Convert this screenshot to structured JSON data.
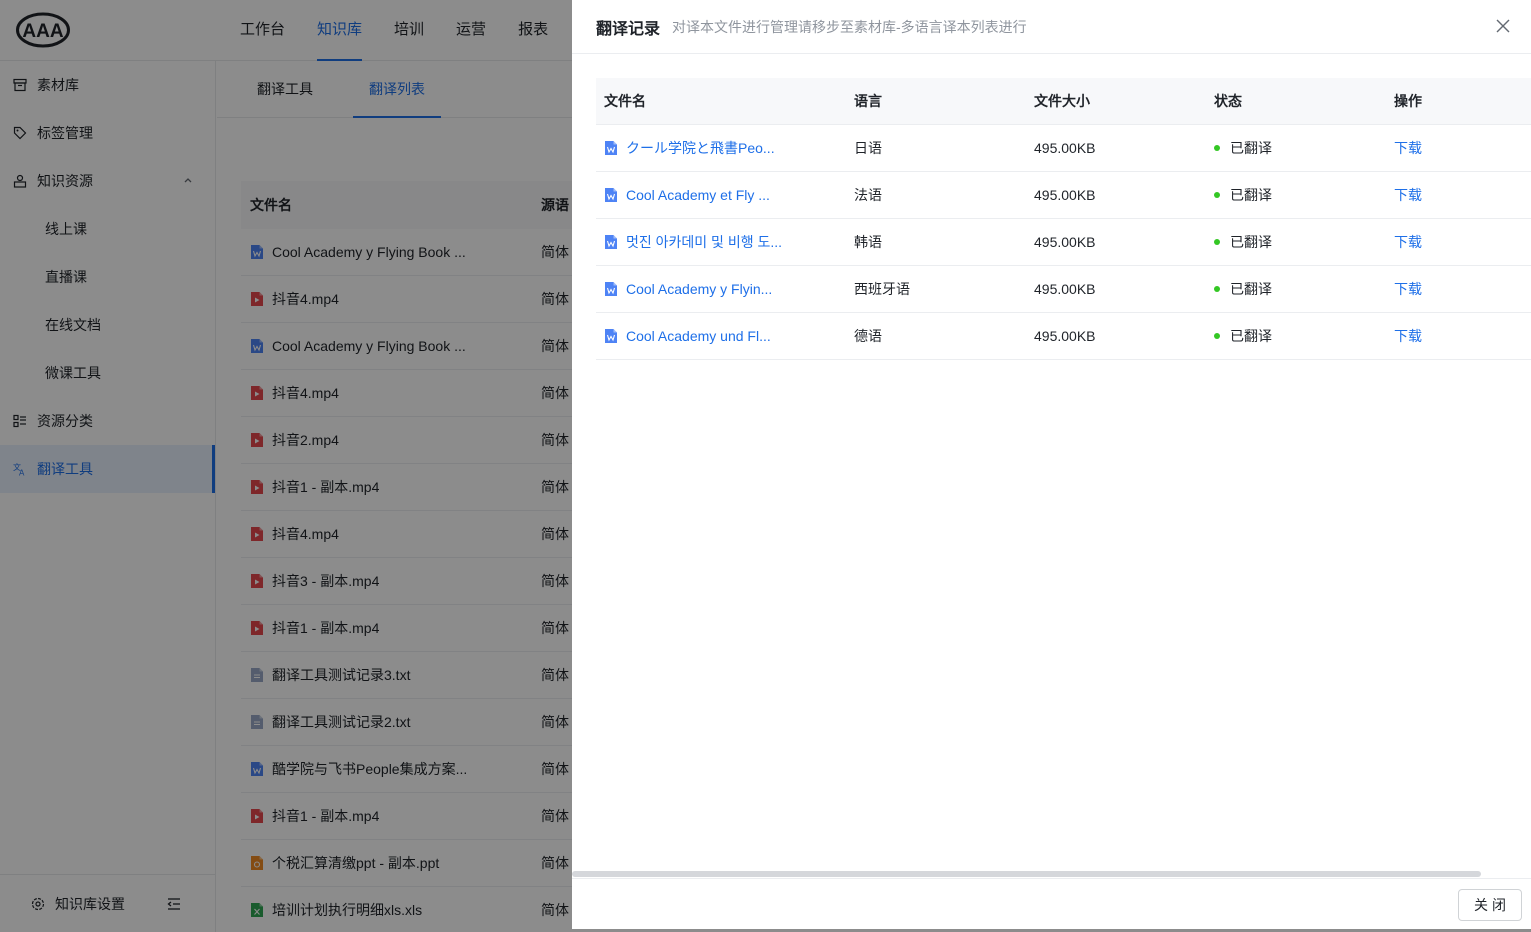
{
  "app": {
    "logo_text": "AAA",
    "top_nav": [
      "工作台",
      "知识库",
      "培训",
      "运营",
      "报表"
    ],
    "top_nav_active": 1
  },
  "sidebar": {
    "items": [
      {
        "label": "素材库",
        "icon": "archive-icon"
      },
      {
        "label": "标签管理",
        "icon": "tag-icon"
      },
      {
        "label": "知识资源",
        "icon": "resource-icon"
      },
      {
        "label": "线上课"
      },
      {
        "label": "直播课"
      },
      {
        "label": "在线文档"
      },
      {
        "label": "微课工具"
      },
      {
        "label": "资源分类",
        "icon": "category-icon"
      },
      {
        "label": "翻译工具",
        "icon": "translate-icon"
      }
    ],
    "footer_label": "知识库设置"
  },
  "subtabs": [
    "翻译工具",
    "翻译列表"
  ],
  "list": {
    "headers": [
      "文件名",
      "源语"
    ],
    "rows": [
      {
        "name": "Cool Academy y Flying Book ...",
        "type": "doc",
        "src": "简体"
      },
      {
        "name": "抖音4.mp4",
        "type": "video",
        "src": "简体"
      },
      {
        "name": "Cool Academy y Flying Book ...",
        "type": "doc",
        "src": "简体"
      },
      {
        "name": "抖音4.mp4",
        "type": "video",
        "src": "简体"
      },
      {
        "name": "抖音2.mp4",
        "type": "video",
        "src": "简体"
      },
      {
        "name": "抖音1 - 副本.mp4",
        "type": "video",
        "src": "简体"
      },
      {
        "name": "抖音4.mp4",
        "type": "video",
        "src": "简体"
      },
      {
        "name": "抖音3 - 副本.mp4",
        "type": "video",
        "src": "简体"
      },
      {
        "name": "抖音1 - 副本.mp4",
        "type": "video",
        "src": "简体"
      },
      {
        "name": "翻译工具测试记录3.txt",
        "type": "txt",
        "src": "简体"
      },
      {
        "name": "翻译工具测试记录2.txt",
        "type": "txt",
        "src": "简体"
      },
      {
        "name": "酷学院与飞书People集成方案...",
        "type": "doc",
        "src": "简体"
      },
      {
        "name": "抖音1 - 副本.mp4",
        "type": "video",
        "src": "简体"
      },
      {
        "name": "个税汇算清缴ppt - 副本.ppt",
        "type": "ppt",
        "src": "简体"
      },
      {
        "name": "培训计划执行明细xls.xls",
        "type": "xls",
        "src": "简体"
      }
    ]
  },
  "drawer": {
    "title": "翻译记录",
    "subtitle": "对译本文件进行管理请移步至素材库-多语言译本列表进行",
    "headers": {
      "name": "文件名",
      "lang": "语言",
      "size": "文件大小",
      "status": "状态",
      "op": "操作"
    },
    "rows": [
      {
        "name": "クール学院と飛書Peo...",
        "lang": "日语",
        "size": "495.00KB",
        "status": "已翻译",
        "op": "下载"
      },
      {
        "name": "Cool Academy et Fly ...",
        "lang": "法语",
        "size": "495.00KB",
        "status": "已翻译",
        "op": "下载"
      },
      {
        "name": "멋진 아카데미 및 비행 도...",
        "lang": "韩语",
        "size": "495.00KB",
        "status": "已翻译",
        "op": "下载"
      },
      {
        "name": "Cool Academy y Flyin...",
        "lang": "西班牙语",
        "size": "495.00KB",
        "status": "已翻译",
        "op": "下载"
      },
      {
        "name": "Cool Academy und Fl...",
        "lang": "德语",
        "size": "495.00KB",
        "status": "已翻译",
        "op": "下载"
      }
    ],
    "close_label": "关闭"
  },
  "colors": {
    "accent": "#1e6fe8",
    "status_ok": "#34c724",
    "doc_icon": "#4e83f5",
    "video_icon": "#e5484d",
    "txt_icon": "#9aa8c7",
    "ppt_icon": "#f08a24",
    "xls_icon": "#2ea652"
  }
}
